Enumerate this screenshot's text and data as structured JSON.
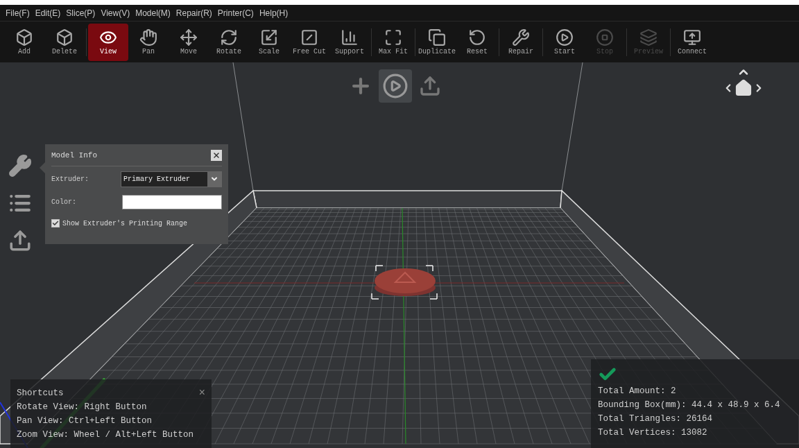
{
  "menu": [
    "File(F)",
    "Edit(E)",
    "Slice(P)",
    "View(V)",
    "Model(M)",
    "Repair(R)",
    "Printer(C)",
    "Help(H)"
  ],
  "toolbar": [
    {
      "label": "Add",
      "selected": false,
      "disabled": false,
      "separator_after": false
    },
    {
      "label": "Delete",
      "selected": false,
      "disabled": false,
      "separator_after": true
    },
    {
      "label": "View",
      "selected": true,
      "disabled": false,
      "separator_after": false
    },
    {
      "label": "Pan",
      "selected": false,
      "disabled": false,
      "separator_after": false
    },
    {
      "label": "Move",
      "selected": false,
      "disabled": false,
      "separator_after": false
    },
    {
      "label": "Rotate",
      "selected": false,
      "disabled": false,
      "separator_after": false
    },
    {
      "label": "Scale",
      "selected": false,
      "disabled": false,
      "separator_after": false
    },
    {
      "label": "Free Cut",
      "selected": false,
      "disabled": false,
      "separator_after": false
    },
    {
      "label": "Support",
      "selected": false,
      "disabled": false,
      "separator_after": true
    },
    {
      "label": "Max Fit",
      "selected": false,
      "disabled": false,
      "separator_after": true
    },
    {
      "label": "Duplicate",
      "selected": false,
      "disabled": false,
      "separator_after": false
    },
    {
      "label": "Reset",
      "selected": false,
      "disabled": false,
      "separator_after": true
    },
    {
      "label": "Repair",
      "selected": false,
      "disabled": false,
      "separator_after": true
    },
    {
      "label": "Start",
      "selected": false,
      "disabled": false,
      "separator_after": false
    },
    {
      "label": "Stop",
      "selected": false,
      "disabled": true,
      "separator_after": true
    },
    {
      "label": "Preview",
      "selected": false,
      "disabled": true,
      "separator_after": true
    },
    {
      "label": "Connect",
      "selected": false,
      "disabled": false,
      "separator_after": false
    }
  ],
  "model_info": {
    "title": "Model Info",
    "extruder_label": "Extruder:",
    "extruder_value": "Primary Extruder",
    "color_label": "Color:",
    "color": "#ffffff",
    "show_range": {
      "label": "Show Extruder's Printing Range",
      "checked": true
    }
  },
  "shortcuts": {
    "title": "Shortcuts",
    "close": "×",
    "lines": [
      "Rotate View: Right Button",
      "Pan View: Ctrl+Left Button",
      "Zoom View: Wheel / Alt+Left Button"
    ]
  },
  "stats": {
    "lines": [
      "Total Amount: 2",
      "Bounding Box(mm): 44.4 x 48.9 x 6.4",
      "Total Triangles: 26164",
      "Total Vertices: 13082"
    ]
  }
}
